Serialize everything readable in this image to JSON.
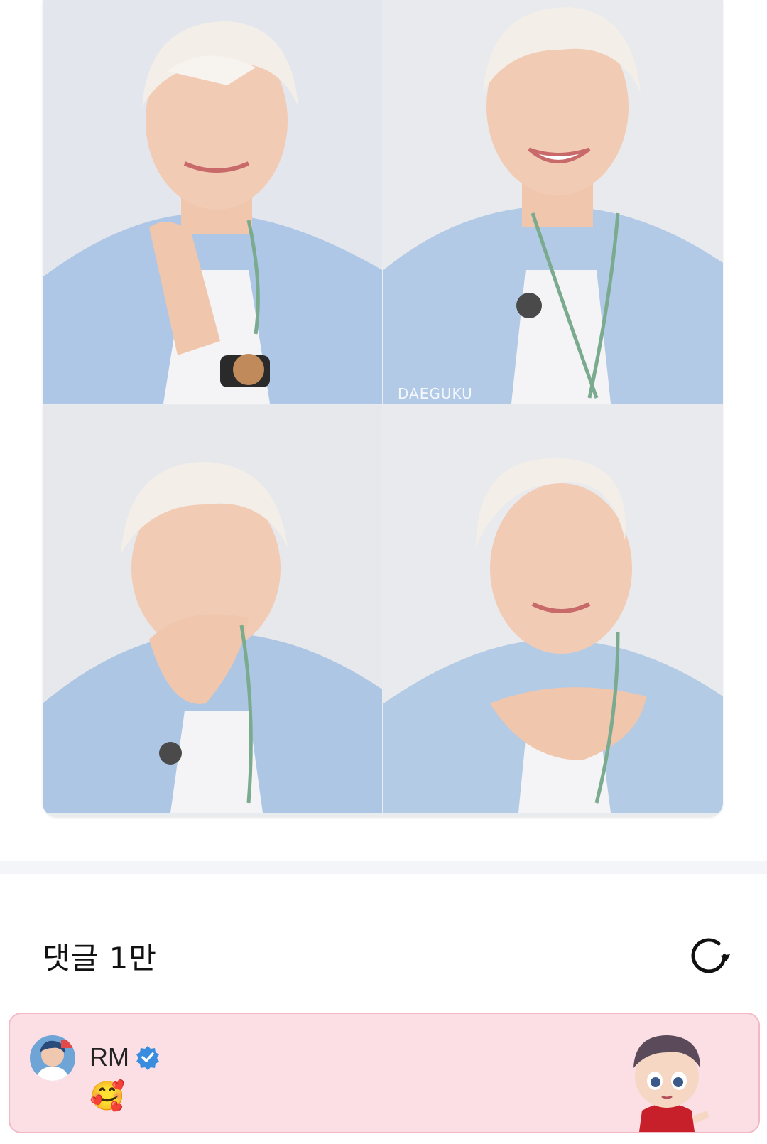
{
  "post": {
    "watermark": "DAEGUKU"
  },
  "comments": {
    "title": "댓글 1만",
    "refresh_icon": "refresh-icon"
  },
  "highlight_comment": {
    "author": "RM",
    "verified_icon": "verified-badge-icon",
    "text": "🥰",
    "sticker": "character-sticker"
  },
  "colors": {
    "highlight_bg": "#fbdfe5",
    "highlight_border": "#f2b9c5",
    "verified": "#3a8dde"
  }
}
